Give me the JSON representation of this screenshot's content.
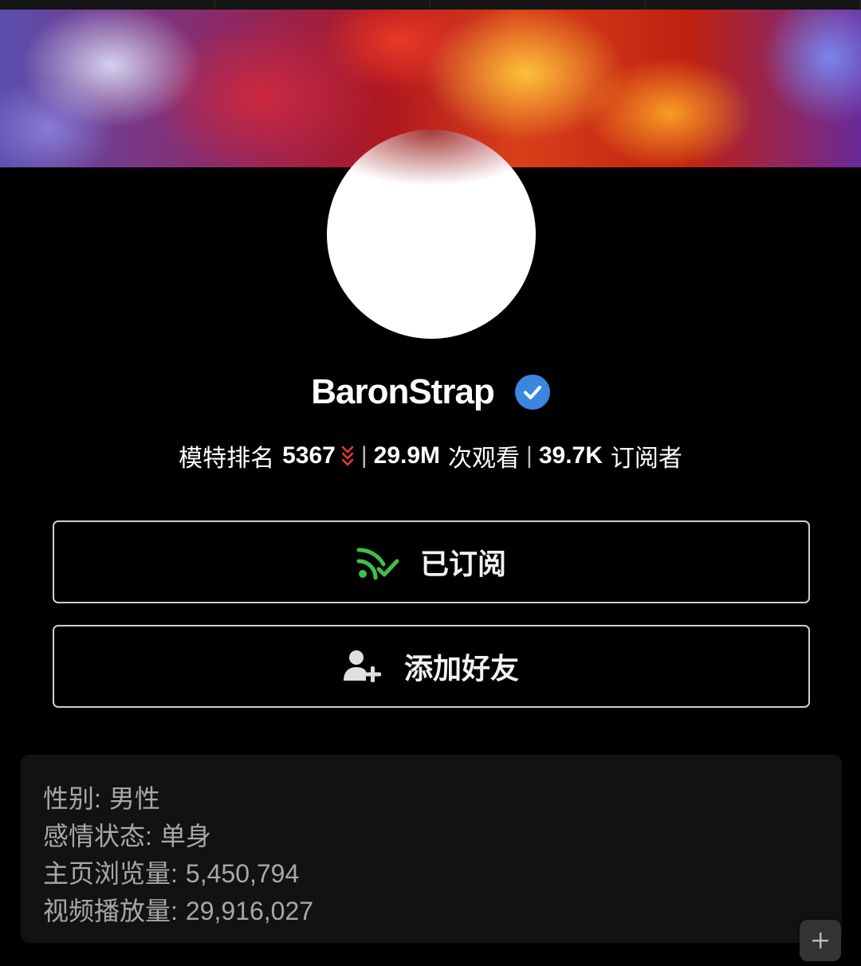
{
  "profile": {
    "username": "BaronStrap",
    "verified_icon": "verified-check-icon",
    "avatar_icon": "avatar"
  },
  "stats": {
    "rank_label": "模特排名",
    "rank_value": "5367",
    "rank_trend_icon": "rank-down-icon",
    "separator": "|",
    "views_value": "29.9M",
    "views_label": "次观看",
    "subscribers_value": "39.7K",
    "subscribers_label": "订阅者"
  },
  "actions": {
    "subscribed_label": "已订阅",
    "subscribed_icon": "rss-check-icon",
    "add_friend_label": "添加好友",
    "add_friend_icon": "user-plus-icon"
  },
  "info": {
    "gender_label": "性别:",
    "gender_value": "男性",
    "relationship_label": "感情状态:",
    "relationship_value": "单身",
    "profile_views_label": "主页浏览量:",
    "profile_views_value": "5,450,794",
    "video_views_label": "视频播放量:",
    "video_views_value": "29,916,027"
  },
  "floating": {
    "plus_icon": "plus-icon"
  },
  "colors": {
    "accent_green": "#3fbf4a",
    "verified_blue": "#3a86e0",
    "rank_down_red": "#e53935",
    "panel_bg": "#121212"
  }
}
